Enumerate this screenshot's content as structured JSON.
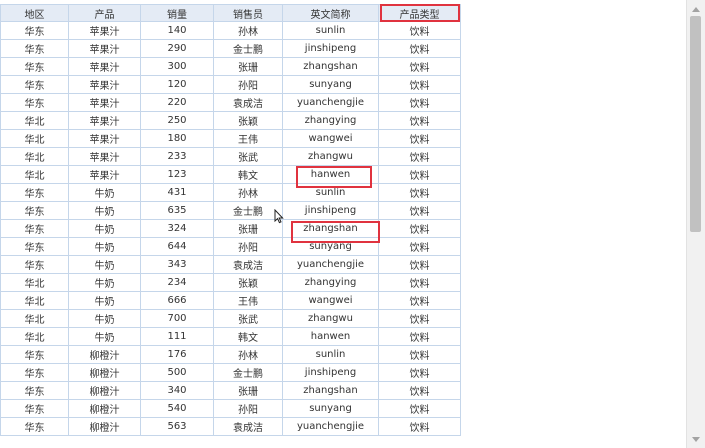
{
  "table": {
    "headers": [
      "地区",
      "产品",
      "销量",
      "销售员",
      "英文简称",
      "产品类型"
    ],
    "rows": [
      [
        "华东",
        "苹果汁",
        "140",
        "孙林",
        "sunlin",
        "饮料"
      ],
      [
        "华东",
        "苹果汁",
        "290",
        "金士鹏",
        "jinshipeng",
        "饮料"
      ],
      [
        "华东",
        "苹果汁",
        "300",
        "张珊",
        "zhangshan",
        "饮料"
      ],
      [
        "华东",
        "苹果汁",
        "120",
        "孙阳",
        "sunyang",
        "饮料"
      ],
      [
        "华东",
        "苹果汁",
        "220",
        "袁成洁",
        "yuanchengjie",
        "饮料"
      ],
      [
        "华北",
        "苹果汁",
        "250",
        "张颖",
        "zhangying",
        "饮料"
      ],
      [
        "华北",
        "苹果汁",
        "180",
        "王伟",
        "wangwei",
        "饮料"
      ],
      [
        "华北",
        "苹果汁",
        "233",
        "张武",
        "zhangwu",
        "饮料"
      ],
      [
        "华北",
        "苹果汁",
        "123",
        "韩文",
        "hanwen",
        "饮料"
      ],
      [
        "华东",
        "牛奶",
        "431",
        "孙林",
        "sunlin",
        "饮料"
      ],
      [
        "华东",
        "牛奶",
        "635",
        "金士鹏",
        "jinshipeng",
        "饮料"
      ],
      [
        "华东",
        "牛奶",
        "324",
        "张珊",
        "zhangshan",
        "饮料"
      ],
      [
        "华东",
        "牛奶",
        "644",
        "孙阳",
        "sunyang",
        "饮料"
      ],
      [
        "华东",
        "牛奶",
        "343",
        "袁成洁",
        "yuanchengjie",
        "饮料"
      ],
      [
        "华北",
        "牛奶",
        "234",
        "张颖",
        "zhangying",
        "饮料"
      ],
      [
        "华北",
        "牛奶",
        "666",
        "王伟",
        "wangwei",
        "饮料"
      ],
      [
        "华北",
        "牛奶",
        "700",
        "张武",
        "zhangwu",
        "饮料"
      ],
      [
        "华北",
        "牛奶",
        "111",
        "韩文",
        "hanwen",
        "饮料"
      ],
      [
        "华东",
        "柳橙汁",
        "176",
        "孙林",
        "sunlin",
        "饮料"
      ],
      [
        "华东",
        "柳橙汁",
        "500",
        "金士鹏",
        "jinshipeng",
        "饮料"
      ],
      [
        "华东",
        "柳橙汁",
        "340",
        "张珊",
        "zhangshan",
        "饮料"
      ],
      [
        "华东",
        "柳橙汁",
        "540",
        "孙阳",
        "sunyang",
        "饮料"
      ],
      [
        "华东",
        "柳橙汁",
        "563",
        "袁成洁",
        "yuanchengjie",
        "饮料"
      ]
    ]
  },
  "colors": {
    "highlight": "#e0333f",
    "header_bg": "#e4ebf5",
    "grid_line": "#c5d6ea"
  },
  "icons": {
    "cursor": "arrow-pointer-icon",
    "scroll_up": "scroll-up-arrow-icon",
    "scroll_down": "scroll-down-arrow-icon"
  }
}
